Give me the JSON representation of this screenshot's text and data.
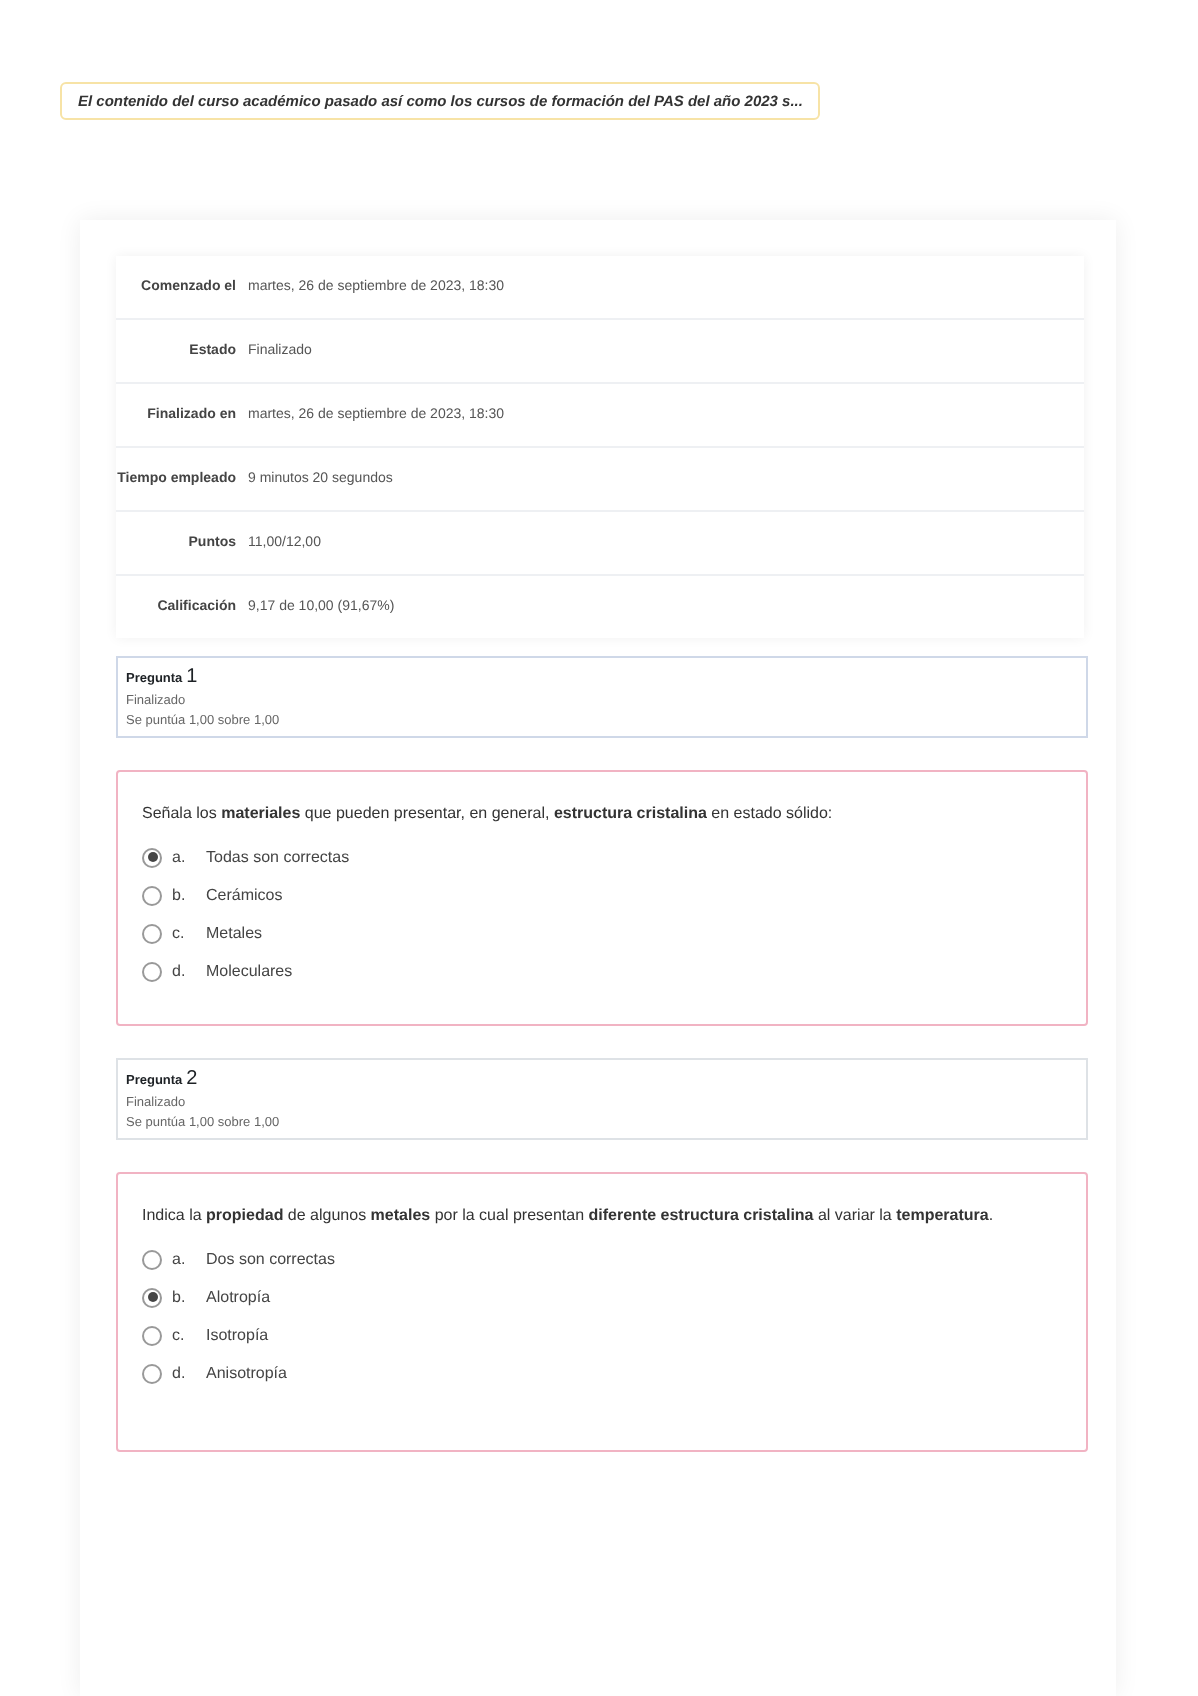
{
  "banner": {
    "text": "El contenido del curso académico pasado así como los cursos de formación del PAS del año 2023 s..."
  },
  "summary": [
    {
      "label": "Comenzado el",
      "value": "martes, 26 de septiembre de 2023, 18:30"
    },
    {
      "label": "Estado",
      "value": "Finalizado"
    },
    {
      "label": "Finalizado en",
      "value": "martes, 26 de septiembre de 2023, 18:30"
    },
    {
      "label": "Tiempo empleado",
      "value": "9 minutos 20 segundos"
    },
    {
      "label": "Puntos",
      "value": "11,00/12,00"
    },
    {
      "label": "Calificación",
      "value": "9,17 de 10,00 (91,67%)"
    }
  ],
  "questions": [
    {
      "heading": "Pregunta",
      "number": "1",
      "state": "Finalizado",
      "grade": "Se puntúa 1,00 sobre 1,00",
      "text": "Señala los **materiales** que pueden presentar, en general, **estructura cristalina** en estado sólido:",
      "options": [
        {
          "letter": "a.",
          "label": "Todas son correctas",
          "selected": true
        },
        {
          "letter": "b.",
          "label": "Cerámicos",
          "selected": false
        },
        {
          "letter": "c.",
          "label": "Metales",
          "selected": false
        },
        {
          "letter": "d.",
          "label": "Moleculares",
          "selected": false
        }
      ]
    },
    {
      "heading": "Pregunta",
      "number": "2",
      "state": "Finalizado",
      "grade": "Se puntúa 1,00 sobre 1,00",
      "text": "Indica la **propiedad** de algunos **metales** por la cual presentan **diferente estructura cristalina** al variar la **temperatura**.",
      "options": [
        {
          "letter": "a.",
          "label": "Dos son correctas",
          "selected": false
        },
        {
          "letter": "b.",
          "label": "Alotropía",
          "selected": true
        },
        {
          "letter": "c.",
          "label": "Isotropía",
          "selected": false
        },
        {
          "letter": "d.",
          "label": "Anisotropía",
          "selected": false
        }
      ]
    }
  ]
}
